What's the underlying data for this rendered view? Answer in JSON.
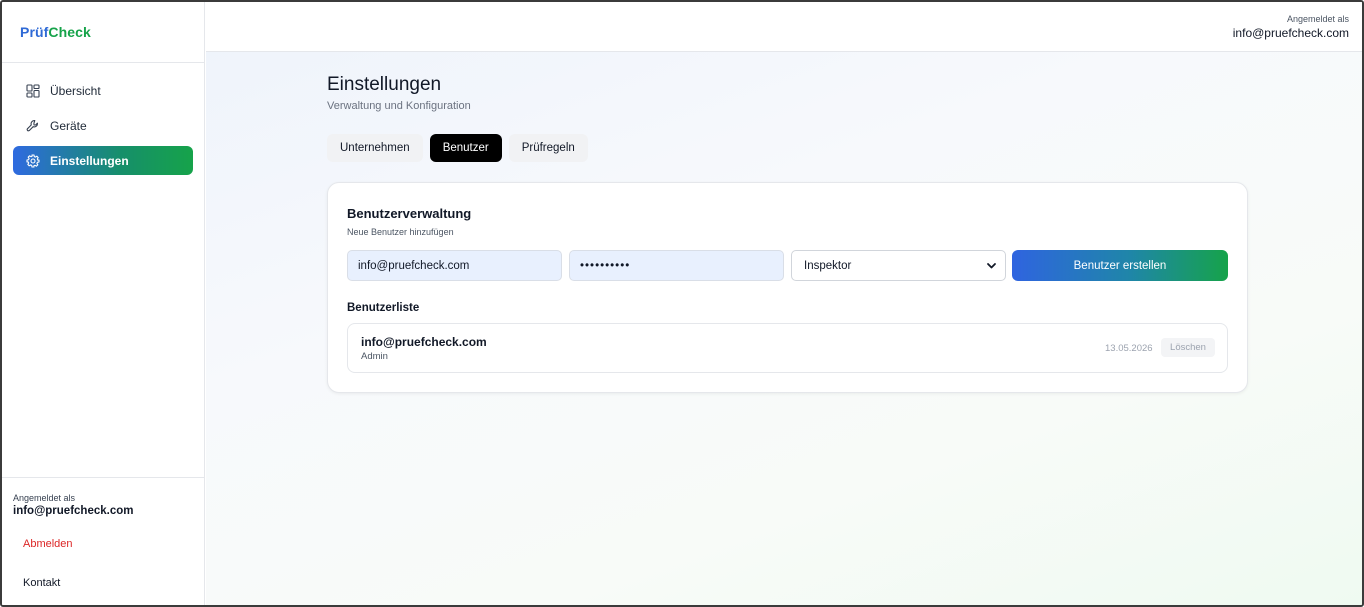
{
  "brand": {
    "part1": "Prüf",
    "part2": "Check",
    "color1": "#2f6ad6",
    "color2": "#16a34a"
  },
  "sidebar": {
    "items": [
      {
        "label": "Übersicht",
        "icon": "dashboard-grid-icon",
        "active": false
      },
      {
        "label": "Geräte",
        "icon": "wrench-icon",
        "active": false
      },
      {
        "label": "Einstellungen",
        "icon": "gear-icon",
        "active": true
      }
    ],
    "user_label": "Angemeldet als",
    "user_email": "info@pruefcheck.com",
    "logout_label": "Abmelden",
    "contact_label": "Kontakt"
  },
  "topbar": {
    "user_label": "Angemeldet als",
    "user_email": "info@pruefcheck.com"
  },
  "page": {
    "title": "Einstellungen",
    "subtitle": "Verwaltung und Konfiguration"
  },
  "tabs": [
    {
      "label": "Unternehmen",
      "active": false
    },
    {
      "label": "Benutzer",
      "active": true
    },
    {
      "label": "Prüfregeln",
      "active": false
    }
  ],
  "user_management": {
    "title": "Benutzerverwaltung",
    "subtitle": "Neue Benutzer hinzufügen",
    "email_value": "info@pruefcheck.com",
    "password_value": "••••••••••",
    "role_selected": "Inspektor",
    "create_button": "Benutzer erstellen",
    "list_title": "Benutzerliste",
    "users": [
      {
        "email": "info@pruefcheck.com",
        "role": "Admin",
        "date": "13.05.2026",
        "delete_label": "Löschen"
      }
    ]
  },
  "colors": {
    "accent_start": "#2f6ae0",
    "accent_end": "#16a34a",
    "danger": "#dc2626"
  }
}
